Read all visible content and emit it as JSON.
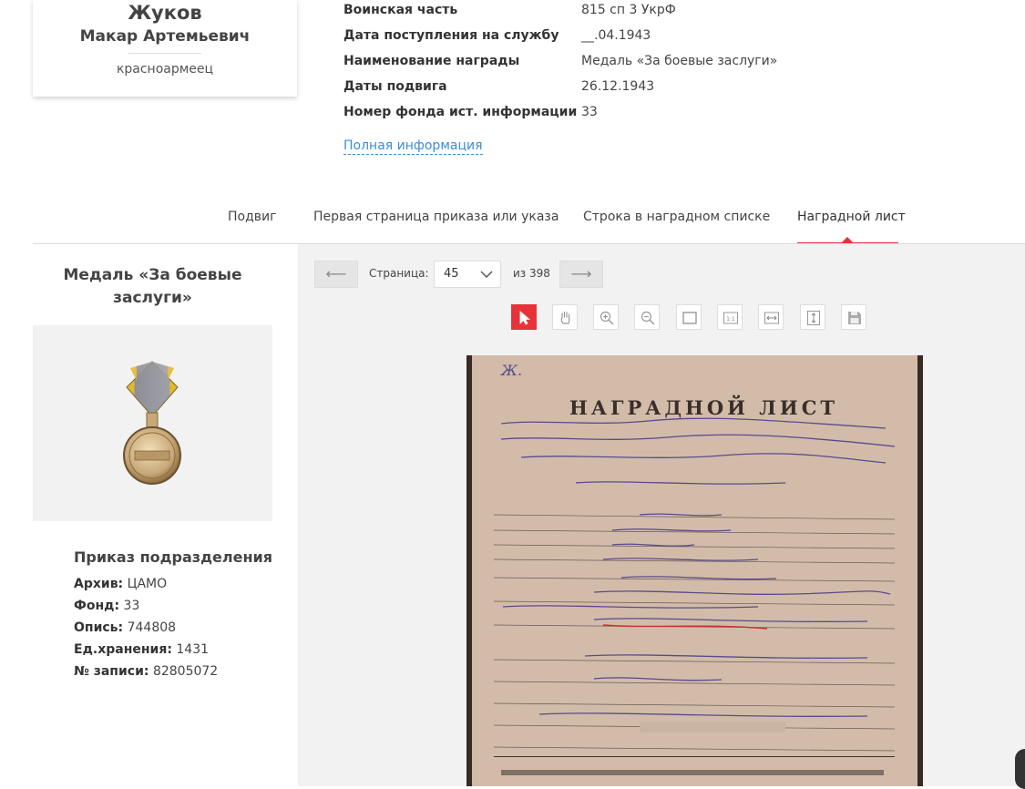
{
  "person": {
    "last_name": "Жуков",
    "first_name": "Макар Артемьевич",
    "rank": "красноармеец"
  },
  "info": {
    "rows": [
      {
        "key": "Воинская часть",
        "value": "815 сп 3 УкрФ"
      },
      {
        "key": "Дата поступления на службу",
        "value": "__.04.1943"
      },
      {
        "key": "Наименование награды",
        "value": "Медаль «За боевые заслуги»"
      },
      {
        "key": "Даты подвига",
        "value": "26.12.1943"
      },
      {
        "key": "Номер фонда ист. информации",
        "value": "33"
      }
    ],
    "full_link": "Полная информация"
  },
  "tabs": [
    {
      "label": "Подвиг"
    },
    {
      "label": "Первая страница приказа или указа"
    },
    {
      "label": "Строка в наградном списке"
    },
    {
      "label": "Наградной лист",
      "active": true
    }
  ],
  "award": {
    "title": "Медаль «За боевые заслуги»"
  },
  "order": {
    "title": "Приказ подразделения",
    "lines": [
      {
        "key": "Архив:",
        "value": "ЦАМО"
      },
      {
        "key": "Фонд:",
        "value": "33"
      },
      {
        "key": "Опись:",
        "value": "744808"
      },
      {
        "key": "Ед.хранения:",
        "value": "1431"
      },
      {
        "key": "№ записи:",
        "value": "82805072"
      }
    ]
  },
  "viewer": {
    "prev_label": "⟵",
    "next_label": "⟶",
    "page_label": "Страница:",
    "page_value": "45",
    "total_label": "из 398",
    "tools": [
      "cursor-icon",
      "hand-icon",
      "zoom-in-icon",
      "zoom-out-icon",
      "fit-page-icon",
      "actual-size-icon",
      "fit-width-icon",
      "fit-height-icon",
      "save-icon"
    ],
    "doc_heading": "НАГРАДНОЙ ЛИСТ"
  },
  "colors": {
    "accent": "#e6333a",
    "link": "#3a8ed8",
    "panel": "#f2f2f2"
  }
}
